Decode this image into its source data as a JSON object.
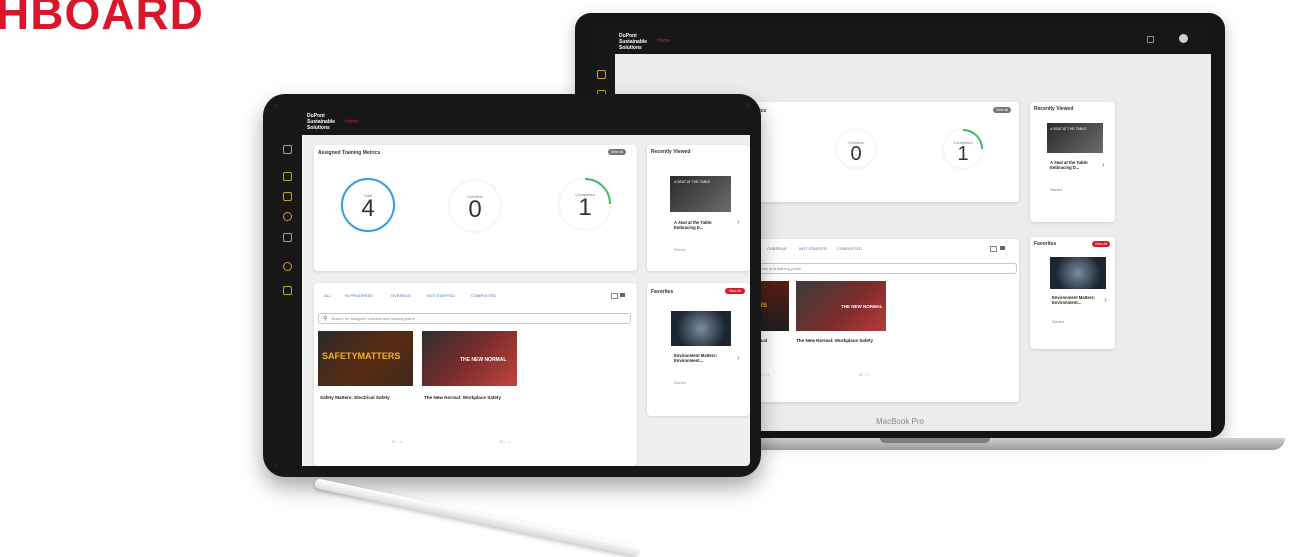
{
  "heading": "HBOARD",
  "brand": [
    "DuPont",
    "Sustainable",
    "Solutions"
  ],
  "menu_link": "Home",
  "laptop": {
    "model_label": "MacBook Pro",
    "metrics_title_fragment": "etrics",
    "view_all_pill": "View all",
    "metrics": [
      {
        "label": "Overdue",
        "value": "0"
      },
      {
        "label": "Completed",
        "value": "1"
      }
    ],
    "tabs": [
      "OVERDUE",
      "NOT STARTED",
      "COMPLETED"
    ],
    "search_placeholder": "courses and training paths",
    "tiles": [
      {
        "title": "ectrical",
        "icons": "⊟ ♡ <"
      },
      {
        "title": "The New Normal: Workplace Safety",
        "icons": "⊟ ♡ <"
      }
    ],
    "recently_viewed": {
      "title": "Recently Viewed",
      "item_title": "A Seat at the Table: Embracing D...",
      "status": "Started"
    },
    "favorites": {
      "title": "Favorites",
      "pill": "View All",
      "item_title": "Environment Matters: Environment...",
      "status": "Started"
    }
  },
  "tablet": {
    "metrics_title": "Assigned Training Metrics",
    "view_all_pill": "View all",
    "metrics": [
      {
        "label": "Total",
        "value": "4"
      },
      {
        "label": "Overdue",
        "value": "0"
      },
      {
        "label": "Completed",
        "value": "1"
      }
    ],
    "tabs": [
      "ALL",
      "IN PROGRESS",
      "OVERDUE",
      "NOT STARTED",
      "COMPLETED"
    ],
    "search_placeholder": "Search for assigned courses and training paths",
    "tiles": [
      {
        "title": "Safety Matters: Electrical Safety",
        "thumb_text": "SAFETYMATTERS",
        "icons": "⊟ ♡ <"
      },
      {
        "title": "The New Normal: Workplace Safety",
        "thumb_text": "THE NEW NORMAL",
        "icons": "⊟ ♡ <"
      }
    ],
    "recently_viewed": {
      "title": "Recently Viewed",
      "thumb_text": "A SEAT AT THE TABLE",
      "item_title": "A Seat at the Table: Embracing D...",
      "status": "Started"
    },
    "favorites": {
      "title": "Favorites",
      "pill": "View All",
      "item_title": "Environment Matters: Environment...",
      "status": "Started"
    }
  },
  "colors": {
    "brand_red": "#d9172b",
    "sidebar": "#171717",
    "ring_blue": "#2f9fe0",
    "ring_green": "#3bbf63",
    "icon_gold": "#c9a227"
  }
}
